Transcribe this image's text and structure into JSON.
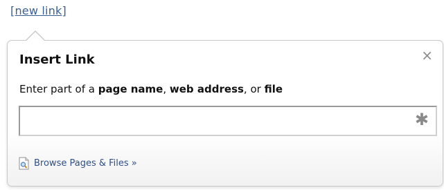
{
  "link": {
    "text": "[new link]"
  },
  "dialog": {
    "title": "Insert Link",
    "close_symbol": "×",
    "instruction": {
      "prefix": "Enter part of a ",
      "term1": "page name",
      "sep1": ", ",
      "term2": "web address",
      "sep2": ", or ",
      "term3": "file"
    },
    "input": {
      "value": "",
      "placeholder": ""
    },
    "required_symbol": "✱",
    "browse": {
      "label": "Browse Pages & Files »",
      "icon": "document-search-icon"
    }
  },
  "colors": {
    "link": "#3a5f94",
    "border": "#c9c9c9",
    "icon_gray": "#8a8a8a"
  }
}
